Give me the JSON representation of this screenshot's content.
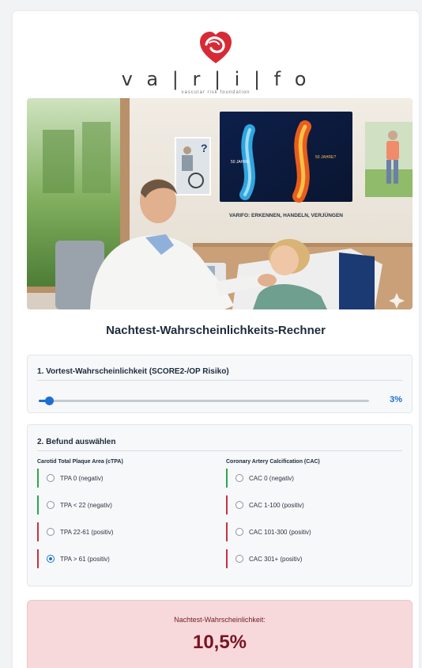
{
  "brand": {
    "wordmark": "v a | r | i | f o",
    "tagline": "vascular risk foundation"
  },
  "hero": {
    "screen_left_label": "50 JAHRE",
    "screen_right_label": "50 JAHRE?",
    "caption": "VARIFO: ERKENNEN, HANDELN, VERJÜNGEN",
    "question_mark": "?"
  },
  "title": "Nachtest-Wahrscheinlichkeits-Rechner",
  "pretest": {
    "heading": "1. Vortest-Wahrscheinlichkeit (SCORE2-/OP Risiko)",
    "value": 3,
    "value_label": "3%"
  },
  "findings": {
    "heading": "2. Befund auswählen",
    "ctpa": {
      "heading": "Carotid Total Plaque Area (cTPA)",
      "options": [
        {
          "label": "TPA 0 (negativ)",
          "result": "negative",
          "checked": false
        },
        {
          "label": "TPA < 22 (negativ)",
          "result": "negative",
          "checked": false
        },
        {
          "label": "TPA 22-61 (positiv)",
          "result": "positive",
          "checked": false
        },
        {
          "label": "TPA > 61 (positiv)",
          "result": "positive",
          "checked": true
        }
      ]
    },
    "cac": {
      "heading": "Coronary Artery Calcification (CAC)",
      "options": [
        {
          "label": "CAC 0 (negativ)",
          "result": "negative",
          "checked": false
        },
        {
          "label": "CAC 1-100 (positiv)",
          "result": "positive",
          "checked": false
        },
        {
          "label": "CAC 101-300 (positiv)",
          "result": "positive",
          "checked": false
        },
        {
          "label": "CAC 301+ (positiv)",
          "result": "positive",
          "checked": false
        }
      ]
    }
  },
  "result": {
    "label": "Nachtest-Wahrscheinlichkeit:",
    "value": "10,5%"
  },
  "colors": {
    "accent": "#1c6fd1",
    "negative": "#2aa84a",
    "positive": "#c8323f",
    "result_bg": "#f7d9dc",
    "result_text": "#7a1320",
    "logo_red": "#d62b36"
  }
}
